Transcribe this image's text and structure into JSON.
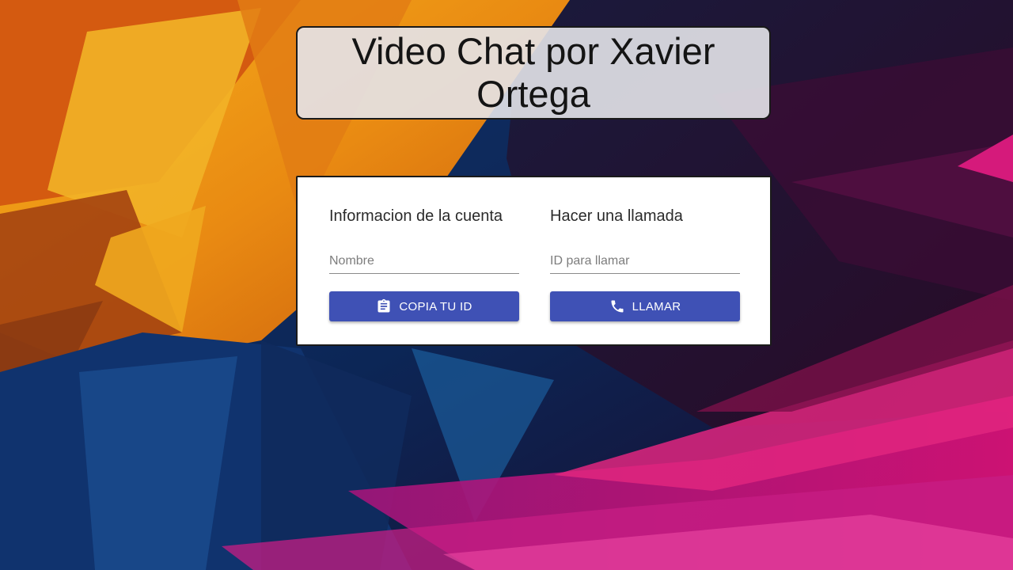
{
  "page": {
    "title": "Video Chat por Xavier Ortega"
  },
  "account": {
    "heading": "Informacion de la cuenta",
    "name_placeholder": "Nombre",
    "name_value": "",
    "copy_button": "COPIA TU ID",
    "copy_icon": "clipboard-icon"
  },
  "call": {
    "heading": "Hacer una llamada",
    "id_placeholder": "ID para llamar",
    "id_value": "",
    "call_button": "LLAMAR",
    "call_icon": "phone-icon"
  },
  "colors": {
    "primary_button": "#3f51b5",
    "card_background": "#ffffff",
    "title_background": "#e4e4ea"
  }
}
